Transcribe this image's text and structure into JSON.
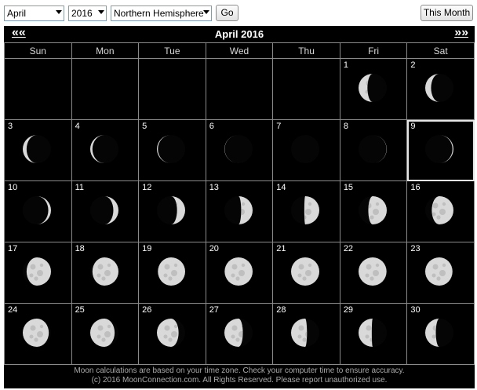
{
  "controls": {
    "month_value": "April",
    "year_value": "2016",
    "hemisphere_value": "Northern Hemisphere",
    "go_label": "Go",
    "this_month_label": "This Month"
  },
  "calendar": {
    "title": "April 2016",
    "prev_label": "««",
    "next_label": "»»",
    "weekdays": [
      "Sun",
      "Mon",
      "Tue",
      "Wed",
      "Thu",
      "Fri",
      "Sat"
    ],
    "highlighted_day": "9",
    "weeks": [
      [
        null,
        null,
        null,
        null,
        null,
        {
          "day": "1",
          "phase": 0.81
        },
        {
          "day": "2",
          "phase": 0.85
        }
      ],
      [
        {
          "day": "3",
          "phase": 0.88
        },
        {
          "day": "4",
          "phase": 0.91
        },
        {
          "day": "5",
          "phase": 0.94
        },
        {
          "day": "6",
          "phase": 0.97
        },
        {
          "day": "7",
          "phase": 0.995
        },
        {
          "day": "8",
          "phase": 0.03
        },
        {
          "day": "9",
          "phase": 0.06
        }
      ],
      [
        {
          "day": "10",
          "phase": 0.1
        },
        {
          "day": "11",
          "phase": 0.14
        },
        {
          "day": "12",
          "phase": 0.18
        },
        {
          "day": "13",
          "phase": 0.22
        },
        {
          "day": "14",
          "phase": 0.26
        },
        {
          "day": "15",
          "phase": 0.3
        },
        {
          "day": "16",
          "phase": 0.34
        }
      ],
      [
        {
          "day": "17",
          "phase": 0.38
        },
        {
          "day": "18",
          "phase": 0.41
        },
        {
          "day": "19",
          "phase": 0.44
        },
        {
          "day": "20",
          "phase": 0.47
        },
        {
          "day": "21",
          "phase": 0.5
        },
        {
          "day": "22",
          "phase": 0.53
        },
        {
          "day": "23",
          "phase": 0.56
        }
      ],
      [
        {
          "day": "24",
          "phase": 0.59
        },
        {
          "day": "25",
          "phase": 0.62
        },
        {
          "day": "26",
          "phase": 0.66
        },
        {
          "day": "27",
          "phase": 0.7
        },
        {
          "day": "28",
          "phase": 0.73
        },
        {
          "day": "29",
          "phase": 0.76
        },
        {
          "day": "30",
          "phase": 0.79
        }
      ]
    ]
  },
  "footer": {
    "line1": "Moon calculations are based on your time zone. Check your computer time to ensure accuracy.",
    "line2": "(c) 2016 MoonConnection.com. All Rights Reserved. Please report unauthorized use."
  },
  "colors": {
    "background": "#000000",
    "moon_lit": "#d9d9d9",
    "moon_shadow": "#000000",
    "grid_line": "#8a8a8a"
  }
}
